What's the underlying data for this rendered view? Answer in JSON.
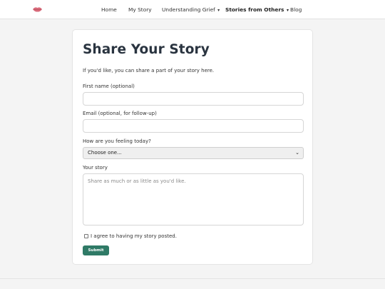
{
  "nav": {
    "logo_icon": "lips-logo-icon",
    "items": [
      {
        "label": "Home"
      },
      {
        "label": "My Story"
      },
      {
        "label": "Understanding Grief",
        "caret": "▾"
      },
      {
        "label": "Stories from Others",
        "caret": "▾"
      },
      {
        "label": "Blog"
      }
    ]
  },
  "form": {
    "title": "Share Your Story",
    "intro": "If you'd like, you can share a part of your story here.",
    "first_name": {
      "label": "First name (optional)",
      "value": "",
      "placeholder": ""
    },
    "email": {
      "label": "Email (optional, for follow-up)",
      "value": "",
      "placeholder": ""
    },
    "feeling": {
      "label": "How are you feeling today?",
      "selected": "Choose one...",
      "caret": "⌄"
    },
    "story": {
      "label": "Your story",
      "placeholder": "Share as much or as little as you'd like."
    },
    "consent": {
      "label": "I agree to having my story posted.",
      "checked": false
    },
    "submit_label": "Submit"
  },
  "colors": {
    "accent": "#2f7a66",
    "background": "#f4f4f4",
    "title": "#2a3440"
  }
}
